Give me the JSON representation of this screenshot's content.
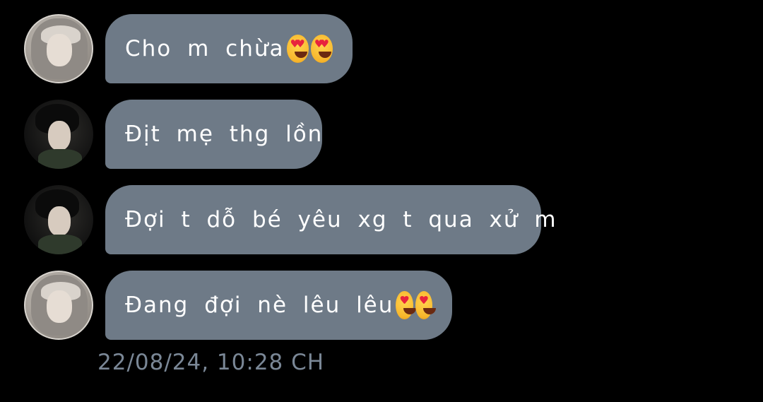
{
  "chat": {
    "messages": [
      {
        "text": "Cho m chừa",
        "emoji": [
          "heart-eyes-emoji",
          "heart-eyes-emoji"
        ],
        "sender": "light-avatar"
      },
      {
        "text": "Địt mẹ thg lồn",
        "emoji": [],
        "sender": "dark-avatar"
      },
      {
        "text": "Đợi t dỗ bé yêu xg t qua xử m",
        "emoji": [],
        "sender": "dark-avatar"
      },
      {
        "text": "Đang đợi nè lêu lêu",
        "emoji": [
          "heart-eyes-emoji",
          "heart-eyes-emoji"
        ],
        "sender": "light-avatar"
      }
    ],
    "timestamp": "22/08/24, 10:28 CH"
  },
  "colors": {
    "background": "#000000",
    "bubble": "#6e7a87",
    "bubble_text": "#ffffff",
    "timestamp": "#7a8796"
  }
}
